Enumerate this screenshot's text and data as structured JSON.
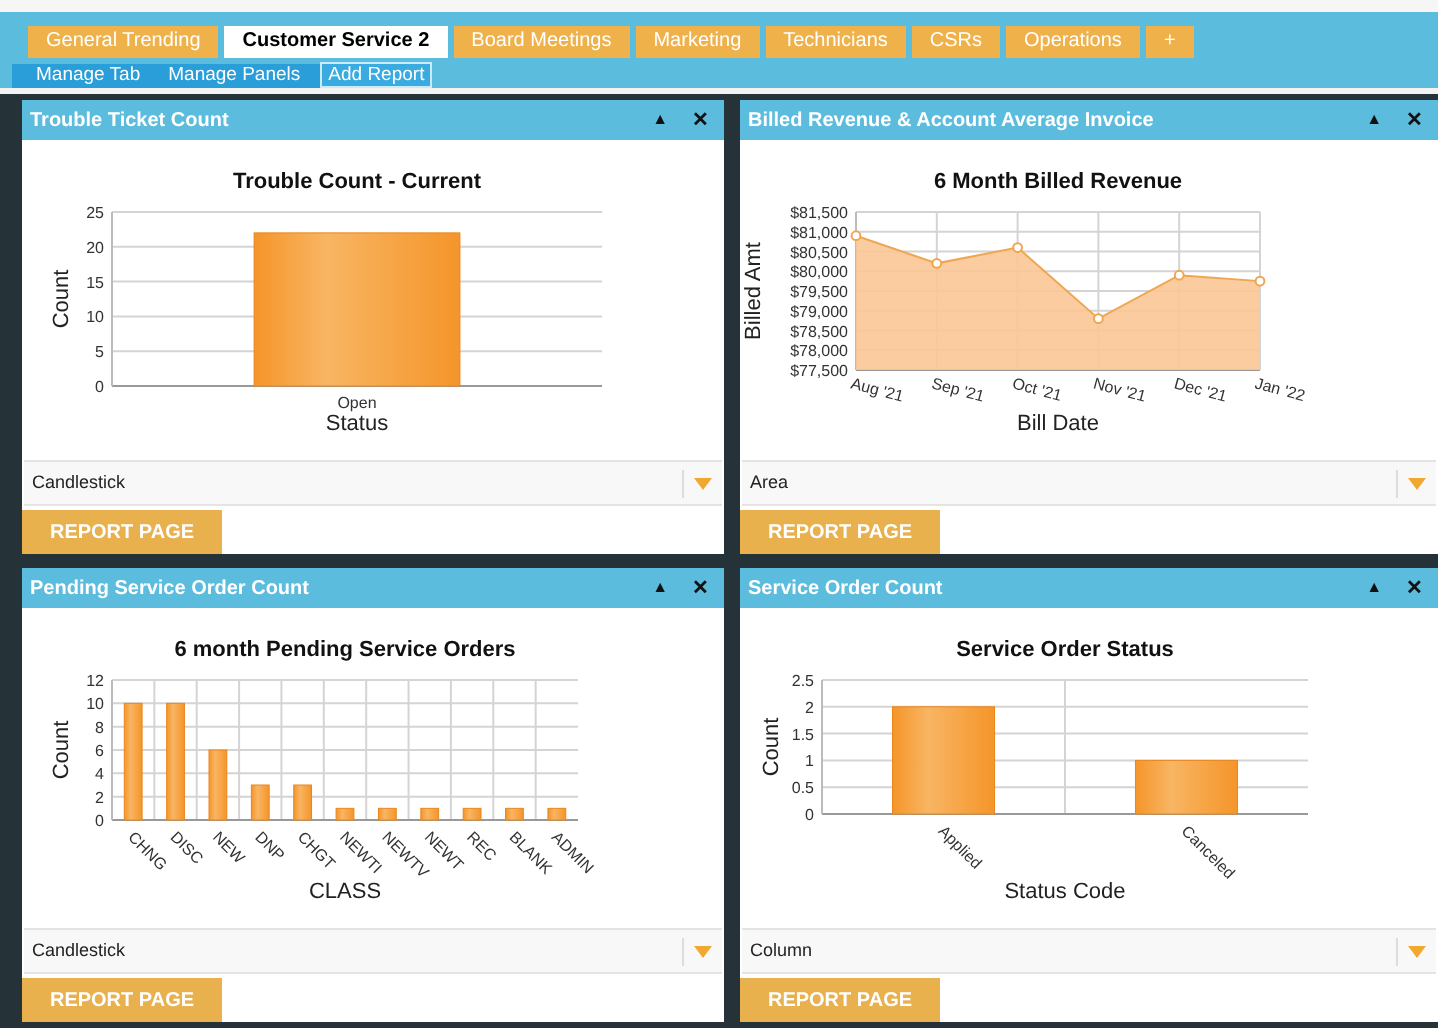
{
  "tabs": [
    {
      "label": "General Trending",
      "selected": false
    },
    {
      "label": "Customer Service 2",
      "selected": true
    },
    {
      "label": "Board Meetings",
      "selected": false
    },
    {
      "label": "Marketing",
      "selected": false
    },
    {
      "label": "Technicians",
      "selected": false
    },
    {
      "label": "CSRs",
      "selected": false
    },
    {
      "label": "Operations",
      "selected": false
    },
    {
      "label": "+",
      "selected": false
    }
  ],
  "subnav": [
    {
      "label": "Manage Tab",
      "selected": false
    },
    {
      "label": "Manage Panels",
      "selected": false
    },
    {
      "label": "Add Report",
      "selected": true
    }
  ],
  "panels": [
    {
      "title": "Trouble Ticket Count",
      "collapse": "▲",
      "close": "✕",
      "chart_type_select": "Candlestick",
      "report_button": "REPORT PAGE",
      "chart_data": {
        "type": "bar",
        "title": "Trouble Count - Current",
        "xlabel": "Status",
        "ylabel": "Count",
        "categories": [
          "Open"
        ],
        "grid": true,
        "series": [
          {
            "color": "#f5952a",
            "values": [
              22
            ]
          }
        ],
        "ylim": [
          0,
          25
        ],
        "yticks": [
          0,
          5,
          10,
          15,
          20,
          25
        ]
      }
    },
    {
      "title": "Billed Revenue & Account Average Invoice",
      "collapse": "▲",
      "close": "✕",
      "chart_type_select": "Area",
      "report_button": "REPORT PAGE",
      "chart_data": {
        "type": "area",
        "title": "6 Month Billed Revenue",
        "xlabel": "Bill Date",
        "ylabel": "Billed Amt",
        "categories": [
          "Aug '21",
          "Sep '21",
          "Oct '21",
          "Nov '21",
          "Dec '21",
          "Jan '22"
        ],
        "grid": true,
        "series": [
          {
            "color": "#f0a550",
            "values": [
              80900,
              80200,
              80600,
              78800,
              79900,
              79750
            ]
          }
        ],
        "ylim": [
          77500,
          81500
        ],
        "yticks": [
          {
            "value": 77500,
            "label": "$77,500"
          },
          {
            "value": 78000,
            "label": "$78,000"
          },
          {
            "value": 78500,
            "label": "$78,500"
          },
          {
            "value": 79000,
            "label": "$79,000"
          },
          {
            "value": 79500,
            "label": "$79,500"
          },
          {
            "value": 80000,
            "label": "$80,000"
          },
          {
            "value": 80500,
            "label": "$80,500"
          },
          {
            "value": 81000,
            "label": "$81,000"
          },
          {
            "value": 81500,
            "label": "$81,500"
          }
        ]
      }
    },
    {
      "title": "Pending Service Order Count",
      "collapse": "▲",
      "close": "✕",
      "chart_type_select": "Candlestick",
      "report_button": "REPORT PAGE",
      "chart_data": {
        "type": "bar",
        "title": "6 month Pending Service Orders",
        "xlabel": "CLASS",
        "ylabel": "Count",
        "categories": [
          "CHNG",
          "DISC",
          "NEW",
          "DNP",
          "CHGT",
          "NEWTI",
          "NEWTV",
          "NEWT",
          "REC",
          "BLANK",
          "ADMIN"
        ],
        "grid": true,
        "series": [
          {
            "color": "#f5952a",
            "values": [
              10,
              10,
              6,
              3,
              3,
              1,
              1,
              1,
              1,
              1,
              1
            ]
          }
        ],
        "ylim": [
          0,
          12
        ],
        "yticks": [
          0,
          2,
          4,
          6,
          8,
          10,
          12
        ]
      }
    },
    {
      "title": "Service Order Count",
      "collapse": "▲",
      "close": "✕",
      "chart_type_select": "Column",
      "report_button": "REPORT PAGE",
      "chart_data": {
        "type": "bar",
        "title": "Service Order Status",
        "xlabel": "Status Code",
        "ylabel": "Count",
        "categories": [
          "Applied",
          "Canceled"
        ],
        "grid": true,
        "series": [
          {
            "color": "#f5952a",
            "values": [
              2,
              1
            ]
          }
        ],
        "ylim": [
          0,
          2.5
        ],
        "yticks": [
          0,
          0.5,
          1,
          1.5,
          2,
          2.5
        ]
      }
    }
  ]
}
